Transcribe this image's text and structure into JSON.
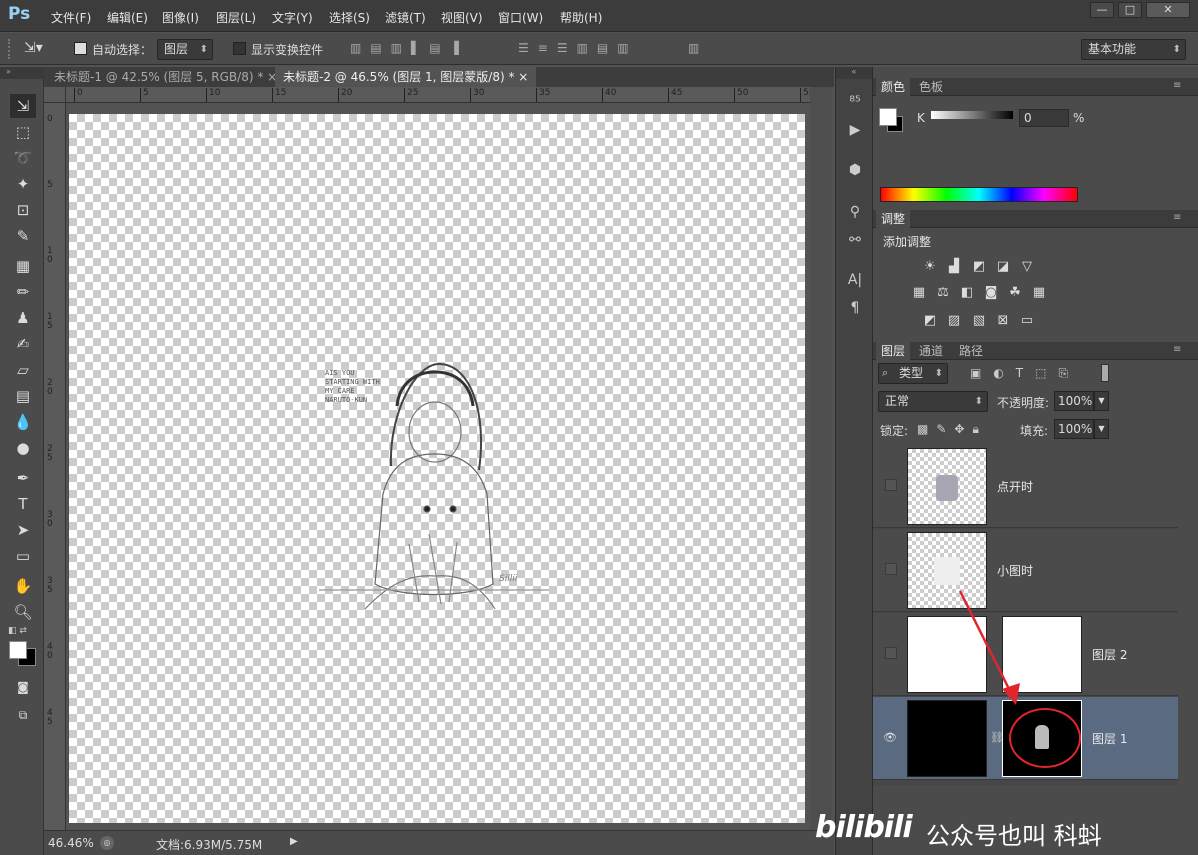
{
  "app": {
    "logo": "Ps"
  },
  "menu": [
    "文件(F)",
    "编辑(E)",
    "图像(I)",
    "图层(L)",
    "文字(Y)",
    "选择(S)",
    "滤镜(T)",
    "视图(V)",
    "窗口(W)",
    "帮助(H)"
  ],
  "window_controls": {
    "minimize": "—",
    "restore": "□",
    "close": "✕"
  },
  "options": {
    "auto_select_label": "自动选择：",
    "auto_select_value": "图层",
    "show_transform_label": "显示变换控件",
    "workspace": "基本功能"
  },
  "tabs": [
    {
      "label": "未标题-1 @ 42.5% (图层 5, RGB/8) *",
      "close": "×"
    },
    {
      "label": "未标题-2 @ 46.5% (图层 1, 图层蒙版/8) *",
      "close": "×"
    }
  ],
  "ruler": {
    "top": [
      "0",
      "5",
      "10",
      "15",
      "20",
      "25",
      "30",
      "35",
      "40",
      "45",
      "50",
      "55"
    ],
    "left": [
      "0",
      "5",
      "1\n0",
      "1\n5",
      "2\n0",
      "2\n5",
      "3\n0",
      "3\n5",
      "4\n0",
      "4\n5"
    ]
  },
  "canvas_text": {
    "handwriting": "AIS YOU\nSTARTING WITH\nMY CARE\nNARUTO-KUN",
    "signature": "Sillii"
  },
  "status": {
    "zoom": "46.46%",
    "doc": "文档:6.93M/5.75M"
  },
  "color_panel": {
    "tabs": [
      "颜色",
      "色板"
    ],
    "channel": "K",
    "value": "0",
    "unit": "%"
  },
  "adjust_panel": {
    "tab": "调整",
    "title": "添加调整"
  },
  "layers_panel": {
    "tabs": [
      "图层",
      "通道",
      "路径"
    ],
    "filter": "类型",
    "blend_mode": "正常",
    "opacity_label": "不透明度:",
    "opacity": "100%",
    "lock_label": "锁定:",
    "fill_label": "填充:",
    "fill": "100%",
    "layers": [
      {
        "name": "点开时",
        "visible": false
      },
      {
        "name": "小图时",
        "visible": false
      },
      {
        "name": "图层 2",
        "visible": false
      },
      {
        "name": "图层 1",
        "visible": true
      }
    ]
  },
  "watermark": {
    "brand": "bilibili",
    "text": "公众号也叫 科蚪"
  },
  "colors": {
    "accent_arrow": "#e0262c",
    "selected_layer": "#5a6a80"
  }
}
